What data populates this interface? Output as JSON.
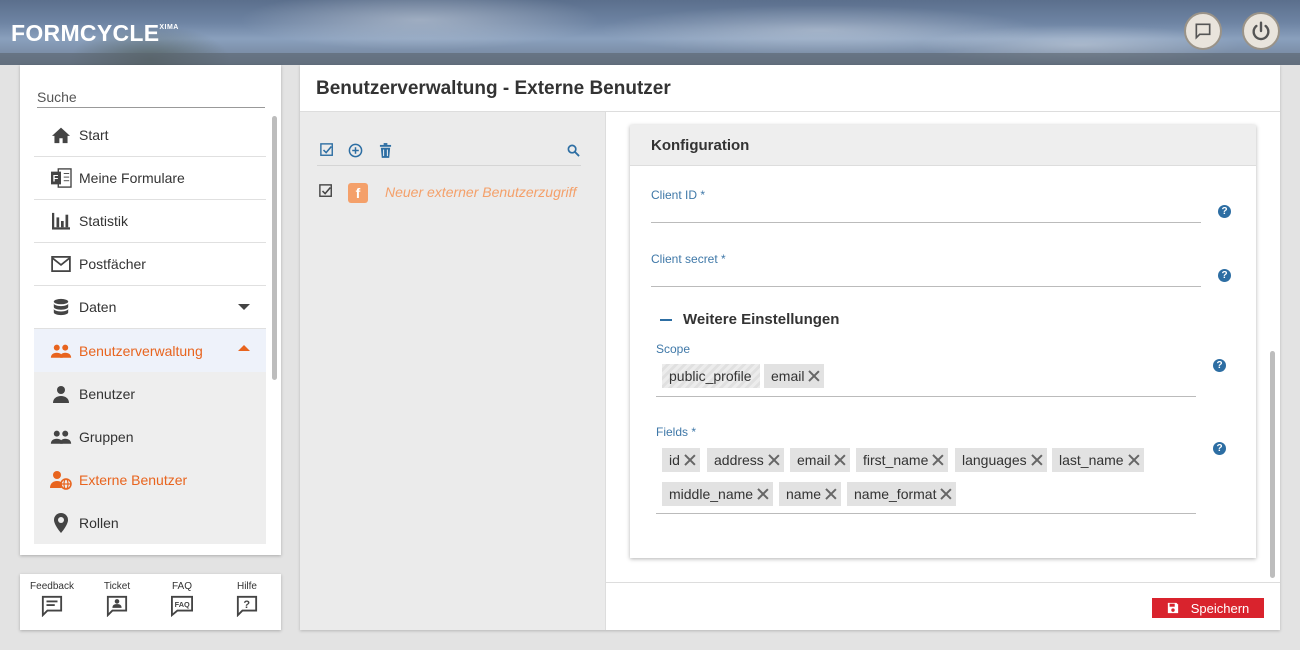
{
  "app": {
    "logo": "FORMCYCLE",
    "logo_sup": "XIMA"
  },
  "header": {
    "icons": [
      "chat-icon",
      "power-icon"
    ]
  },
  "sidebar": {
    "search_placeholder": "Suche",
    "items": [
      {
        "label": "Start",
        "icon": "home-icon"
      },
      {
        "label": "Meine Formulare",
        "icon": "forms-icon"
      },
      {
        "label": "Statistik",
        "icon": "bar-chart-icon"
      },
      {
        "label": "Postfächer",
        "icon": "mail-icon"
      },
      {
        "label": "Daten",
        "icon": "database-icon"
      },
      {
        "label": "Benutzerverwaltung",
        "icon": "users-icon"
      },
      {
        "label": "Benutzer",
        "icon": "user-icon"
      },
      {
        "label": "Gruppen",
        "icon": "group-icon"
      },
      {
        "label": "Externe Benutzer",
        "icon": "external-user-icon"
      },
      {
        "label": "Rollen",
        "icon": "role-icon"
      }
    ]
  },
  "help_bar": {
    "items": [
      {
        "label": "Feedback",
        "icon": "feedback-icon"
      },
      {
        "label": "Ticket",
        "icon": "ticket-icon"
      },
      {
        "label": "FAQ",
        "icon": "faq-icon"
      },
      {
        "label": "Hilfe",
        "icon": "help-icon"
      }
    ]
  },
  "main": {
    "title": "Benutzerverwaltung - Externe Benutzer",
    "list": {
      "toolbar_icons": [
        "select-all-icon",
        "add-icon",
        "delete-icon",
        "search-icon"
      ],
      "items": [
        {
          "label": "Neuer externer Benutzerzugriff",
          "badge": "f",
          "badge_color": "#f4a06a"
        }
      ]
    },
    "config": {
      "title": "Konfiguration",
      "client_id_label": "Client ID *",
      "client_id_value": "",
      "client_secret_label": "Client secret *",
      "client_secret_value": "",
      "section_title": "Weitere Einstellungen",
      "scope_label": "Scope",
      "scope_chips": [
        "public_profile",
        "email"
      ],
      "fields_label": "Fields *",
      "fields_chips": [
        "id",
        "address",
        "email",
        "first_name",
        "languages",
        "last_name",
        "middle_name",
        "name",
        "name_format"
      ],
      "help_mark": "?"
    },
    "save_label": "Speichern"
  },
  "colors": {
    "accent": "#e8641e",
    "link_blue": "#3f78a8",
    "save_red": "#d9232d"
  }
}
